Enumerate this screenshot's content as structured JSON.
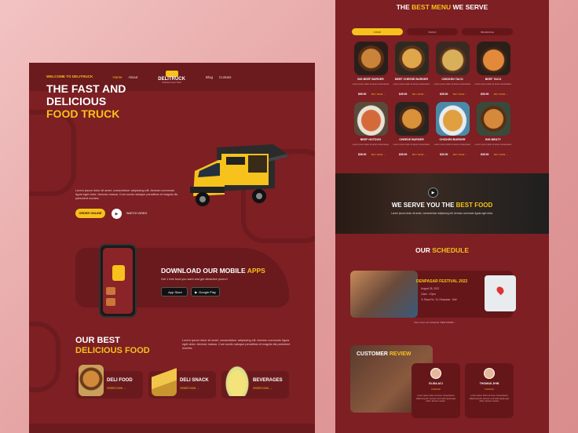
{
  "nav": {
    "home": "Home",
    "about": "About",
    "blog": "Blog",
    "contact": "Contact",
    "brand": "DELITRUCK",
    "tagline": "Delicious Food Truck"
  },
  "hero": {
    "welcome": "WELCOME TO DELITRUCK",
    "title_line1": "THE FAST AND",
    "title_line2": "DELICIOUS",
    "title_line3": "FOOD TRUCK",
    "lorem": "Lorem ipsum dolor sit amet, consectetuer adipiscing elit. Aenean commodo ligula eget dolor. Aenean massa. Cum sociis natoque penatibus et magnis dis parturient montes.",
    "order_btn": "ORDER ONLINE",
    "watch": "WATCH VIDEO"
  },
  "download": {
    "title_main": "DOWNLOAD OUR MOBILE ",
    "title_accent": "APPS",
    "desc": "Get 1 free food you want and get attractive promo!",
    "appstore_small": "Download on the",
    "appstore": "App Store",
    "googleplay_small": "GET IT ON",
    "googleplay": "Google Play"
  },
  "best": {
    "line1": "OUR BEST",
    "line2": "DELICIOUS FOOD",
    "lorem": "Lorem ipsum dolor sit amet, consectetuer adipiscing elit. Aenean commodo ligula eget dolor. Aenean massa. Cum sociis natoque penatibus et magnis dis parturient montes.",
    "categories": [
      {
        "name": "DELI FOOD",
        "cta": "ORDER NOW →"
      },
      {
        "name": "DELI SNACK",
        "cta": "ORDER NOW →"
      },
      {
        "name": "BEVERAGES",
        "cta": "ORDER NOW →"
      }
    ]
  },
  "menu": {
    "title_a": "THE ",
    "title_b": "BEST MENU",
    "title_c": " WE SERVE",
    "tabs": [
      "FOOD",
      "SNACK",
      "BEVERAGE"
    ],
    "items": [
      {
        "name": "BIG BEEF BURGER",
        "price": "$65.00"
      },
      {
        "name": "BEEF CHEESE BURGER",
        "price": "$45.00"
      },
      {
        "name": "CHICKEN TACO",
        "price": "$35.00"
      },
      {
        "name": "BEEF TACO",
        "price": "$30.00"
      },
      {
        "name": "BEEF HOTDOG",
        "price": "$38.00"
      },
      {
        "name": "CHEESE BURGER",
        "price": "$35.00"
      },
      {
        "name": "CHICKEN BURGER",
        "price": "$30.00"
      },
      {
        "name": "BIG MEATY",
        "price": "$35.00"
      }
    ],
    "item_lorem": "Lorem ipsum dolor sit amet consectetuer",
    "buy": "BUY NOW →"
  },
  "serve": {
    "title_a": "WE SERVE YOU THE ",
    "title_b": "BEST FOOD",
    "lorem": "Lorem ipsum dolor sit amet, consectetuer adipiscing elit. Aenean commodo ligula eget dolor."
  },
  "schedule": {
    "title_a": "OUR ",
    "title_b": "SCHEDULE",
    "event": "DENPASAR FESTIVAL 2022",
    "date": "August 28, 2022",
    "time": "10am - 10pm",
    "place": "Jl. Raya No. 12, Denpasar - Bali",
    "more": "View more our schedule  VIEW MORE →"
  },
  "review": {
    "title_a": "CUSTOMER ",
    "title_b": "REVIEW",
    "people": [
      {
        "name": "ELISA ACI",
        "role": "Customer"
      },
      {
        "name": "THOMAS JHIN",
        "role": "Customer"
      }
    ],
    "lorem": "Lorem ipsum dolor sit amet, consectetuer adipiscing elit. Aenean commodo ligula eget dolor. Aenean massa."
  }
}
